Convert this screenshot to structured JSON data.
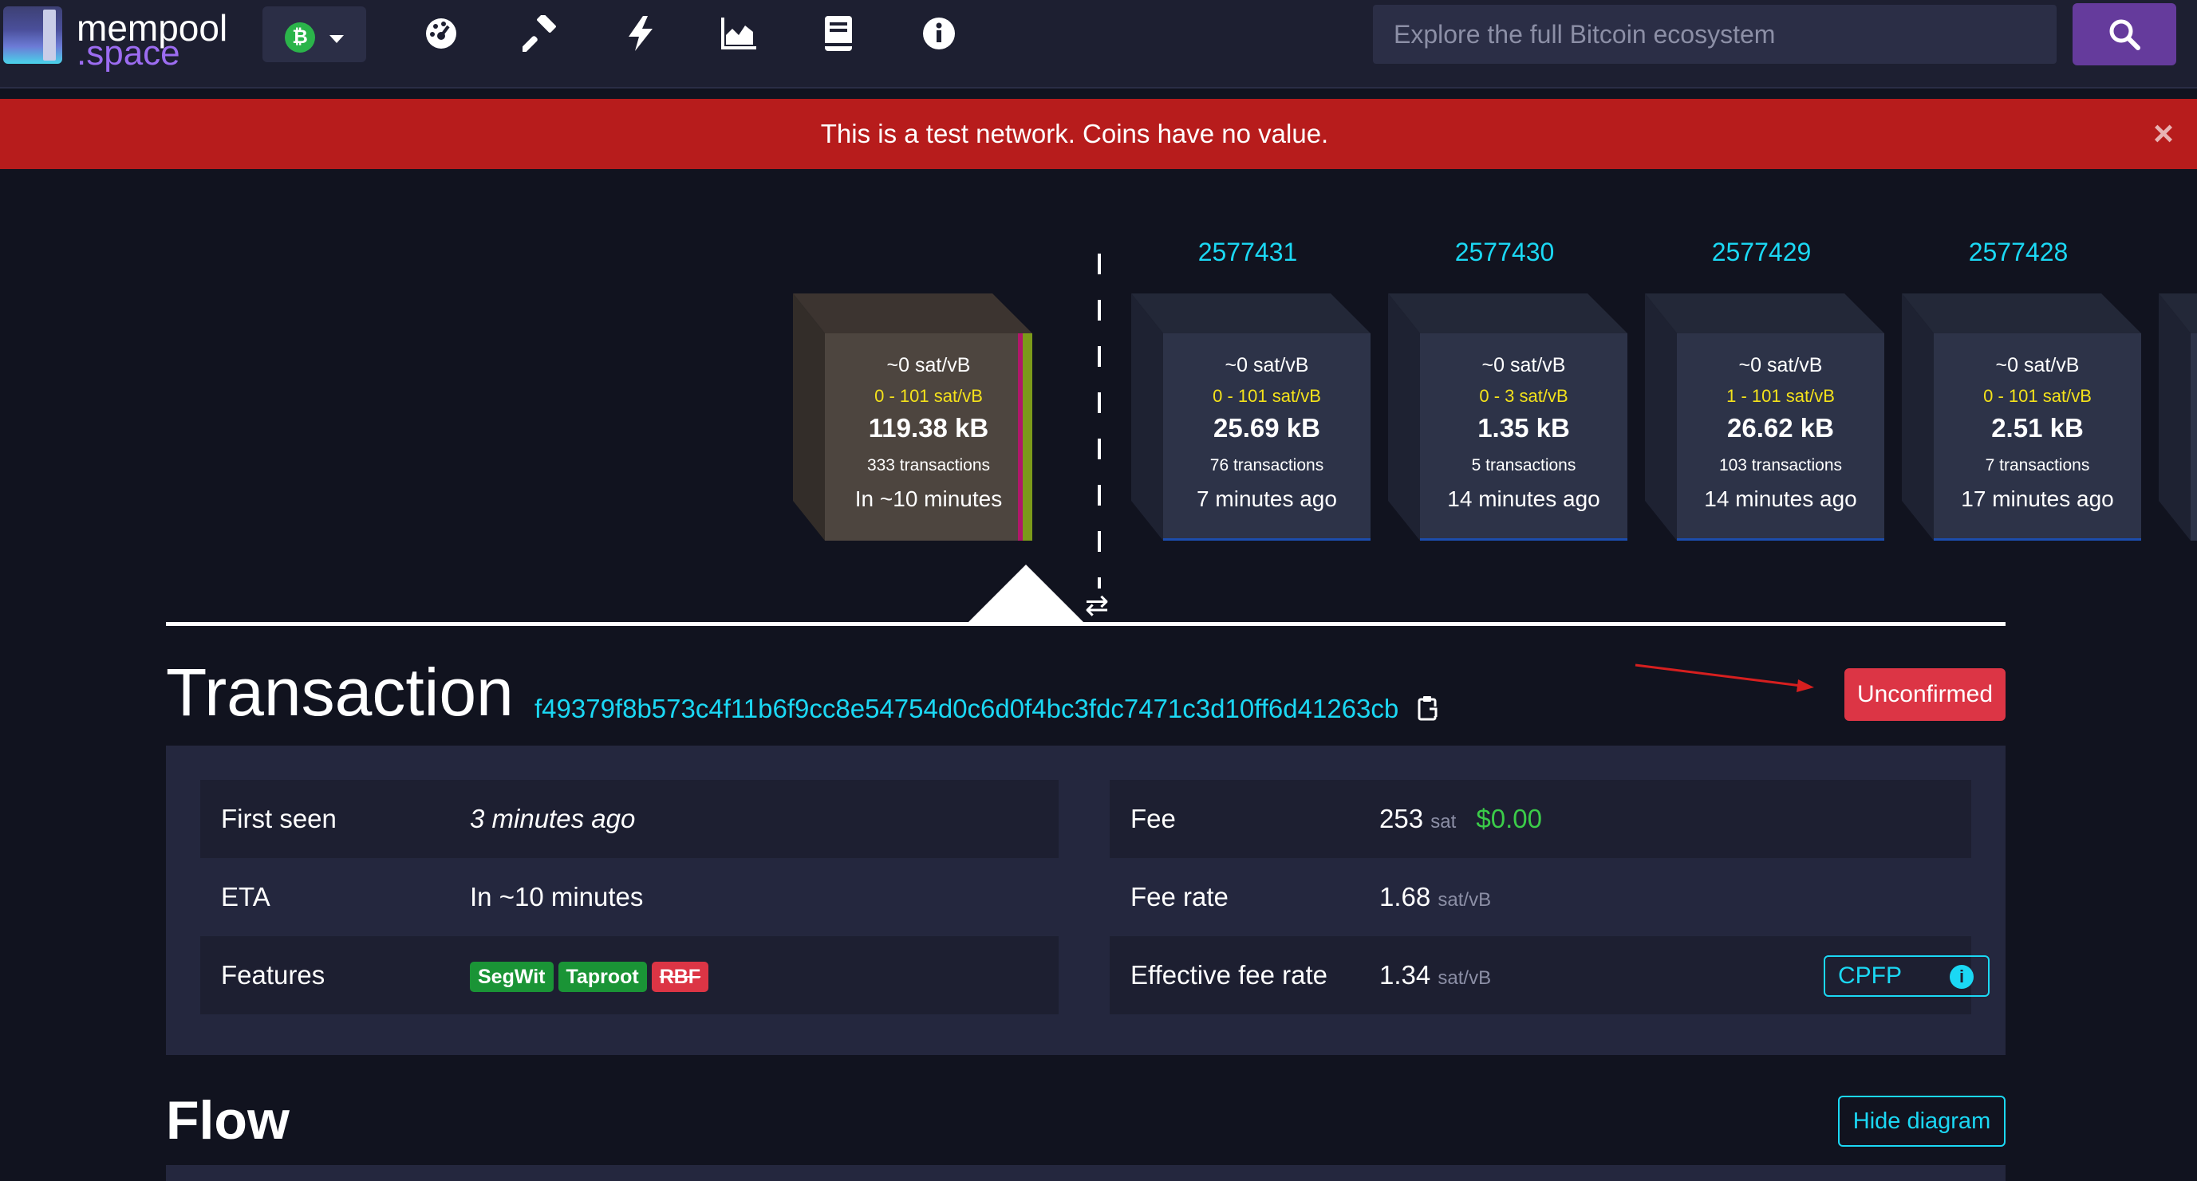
{
  "nav": {
    "logo_line1": "mempool",
    "logo_line2": ".space",
    "network_symbol": "₿",
    "icons": [
      "dashboard-icon",
      "mining-icon",
      "lightning-icon",
      "graphs-icon",
      "docs-icon",
      "about-icon"
    ],
    "search_placeholder": "Explore the full Bitcoin ecosystem",
    "accent": "#653b9c"
  },
  "banner": {
    "text": "This is a test network. Coins have no value.",
    "close": "×",
    "color": "#b71c1c"
  },
  "pending_block": {
    "fee": "~0 sat/vB",
    "range": "0 - 101 sat/vB",
    "size": "119.38 kB",
    "tx": "333 transactions",
    "time": "In ~10 minutes"
  },
  "blocks": [
    {
      "height": "2577431",
      "fee": "~0 sat/vB",
      "range": "0 - 101 sat/vB",
      "size": "25.69 kB",
      "tx": "76 transactions",
      "time": "7 minutes ago"
    },
    {
      "height": "2577430",
      "fee": "~0 sat/vB",
      "range": "0 - 3 sat/vB",
      "size": "1.35 kB",
      "tx": "5 transactions",
      "time": "14 minutes ago"
    },
    {
      "height": "2577429",
      "fee": "~0 sat/vB",
      "range": "1 - 101 sat/vB",
      "size": "26.62 kB",
      "tx": "103 transactions",
      "time": "14 minutes ago"
    },
    {
      "height": "2577428",
      "fee": "~0 sat/vB",
      "range": "0 - 101 sat/vB",
      "size": "2.51 kB",
      "tx": "7 transactions",
      "time": "17 minutes ago"
    }
  ],
  "swap_icon": "⇄",
  "transaction": {
    "title": "Transaction",
    "txid": "f49379f8b573c4f11b6f9cc8e54754d0c6d0f4bc3fdc7471c3d10ff6d41263cb",
    "status": "Unconfirmed",
    "left": {
      "first_seen_label": "First seen",
      "first_seen_value": "3 minutes ago",
      "eta_label": "ETA",
      "eta_value": "In ~10 minutes",
      "features_label": "Features",
      "features": [
        "SegWit",
        "Taproot",
        "RBF"
      ]
    },
    "right": {
      "fee_label": "Fee",
      "fee_value": "253",
      "fee_unit": "sat",
      "fee_fiat": "$0.00",
      "fee_rate_label": "Fee rate",
      "fee_rate_value": "1.68",
      "fee_rate_unit": "sat/vB",
      "eff_label": "Effective fee rate",
      "eff_value": "1.34",
      "eff_unit": "sat/vB",
      "cpfp_label": "CPFP",
      "cpfp_info": "i"
    }
  },
  "flow": {
    "title": "Flow",
    "hide_label": "Hide diagram"
  }
}
